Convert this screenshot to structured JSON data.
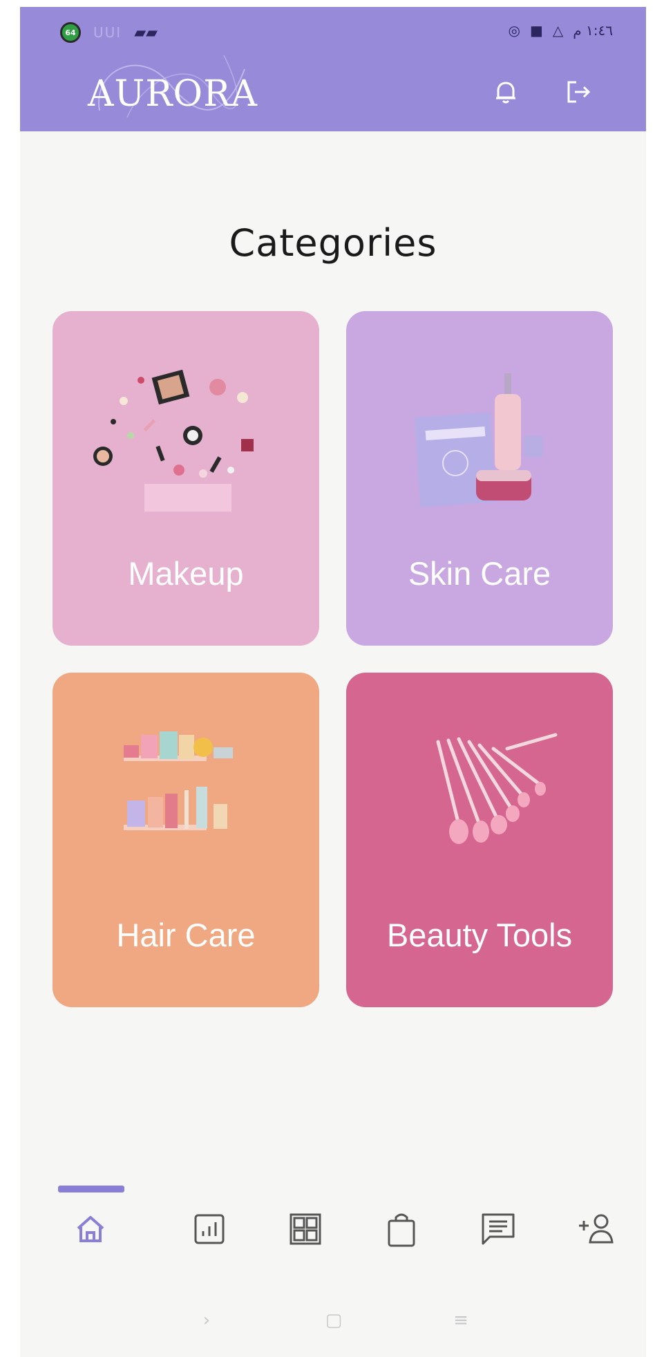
{
  "status_bar": {
    "left_badge": "64",
    "left_text": "UUI",
    "signal": "📶",
    "time": "١:٤٦ م"
  },
  "header": {
    "logo": "AURORA",
    "icons": [
      "bell-icon",
      "logout-icon"
    ]
  },
  "page": {
    "title": "Categories"
  },
  "categories": [
    {
      "label": "Makeup",
      "color": "#e6b1cf"
    },
    {
      "label": "Skin Care",
      "color": "#c9a8e2"
    },
    {
      "label": "Hair Care",
      "color": "#efa882"
    },
    {
      "label": "Beauty Tools",
      "color": "#d4668f"
    }
  ],
  "bottom_nav": {
    "active": "home",
    "items": [
      "home-icon",
      "stats-icon",
      "dashboard-icon",
      "bag-icon",
      "chat-icon",
      "add-user-icon"
    ]
  },
  "system_nav": {
    "back": "›",
    "home": "▢",
    "menu": "≡"
  },
  "colors": {
    "accent": "#978bd9",
    "background": "#f6f7f5"
  }
}
